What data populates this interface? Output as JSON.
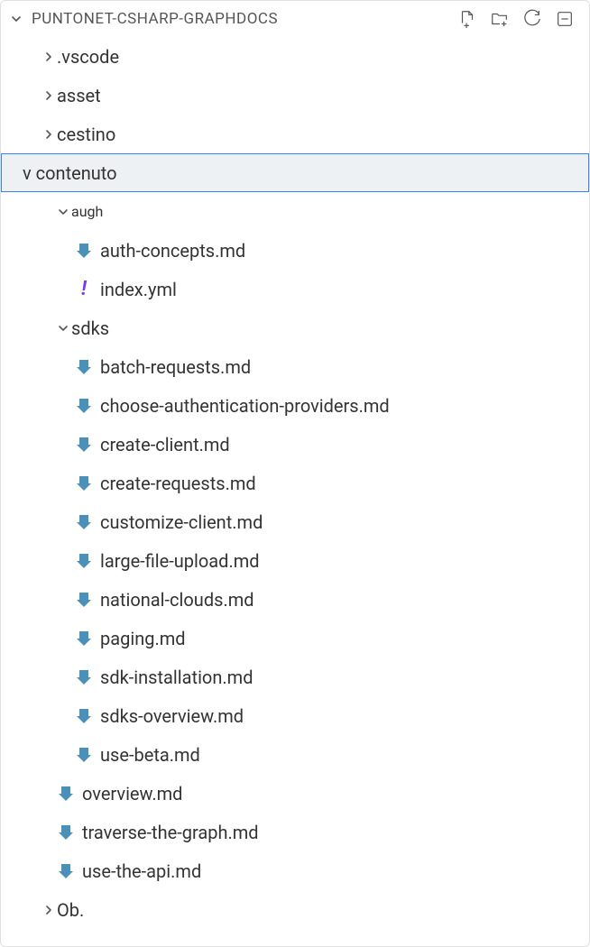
{
  "header": {
    "title": "PUNTONET-CSHARP-GRAPHDOCS"
  },
  "tree": {
    "f_vscode": ".vscode",
    "f_asset": "asset",
    "f_cestino": "cestino",
    "f_contenuto": "v contenuto",
    "f_augh": "augh",
    "auth_concepts": "auth-concepts.md",
    "index_yml": "index.yml",
    "f_sdks": "sdks",
    "batch_requests": "batch-requests.md",
    "choose_auth": "choose-authentication-providers.md",
    "create_client": "create-client.md",
    "create_requests": "create-requests.md",
    "customize_client": "customize-client.md",
    "large_file": "large-file-upload.md",
    "national_clouds": "national-clouds.md",
    "paging": "paging.md",
    "sdk_install": "sdk-installation.md",
    "sdks_overview": "sdks-overview.md",
    "use_beta": "use-beta.md",
    "overview": "overview.md",
    "traverse": "traverse-the-graph.md",
    "use_api": "use-the-api.md",
    "f_ob": "Ob."
  },
  "colors": {
    "accent": "#3b82f6",
    "md_icon": "#4a90b8",
    "yml_icon": "#7c3aed"
  }
}
